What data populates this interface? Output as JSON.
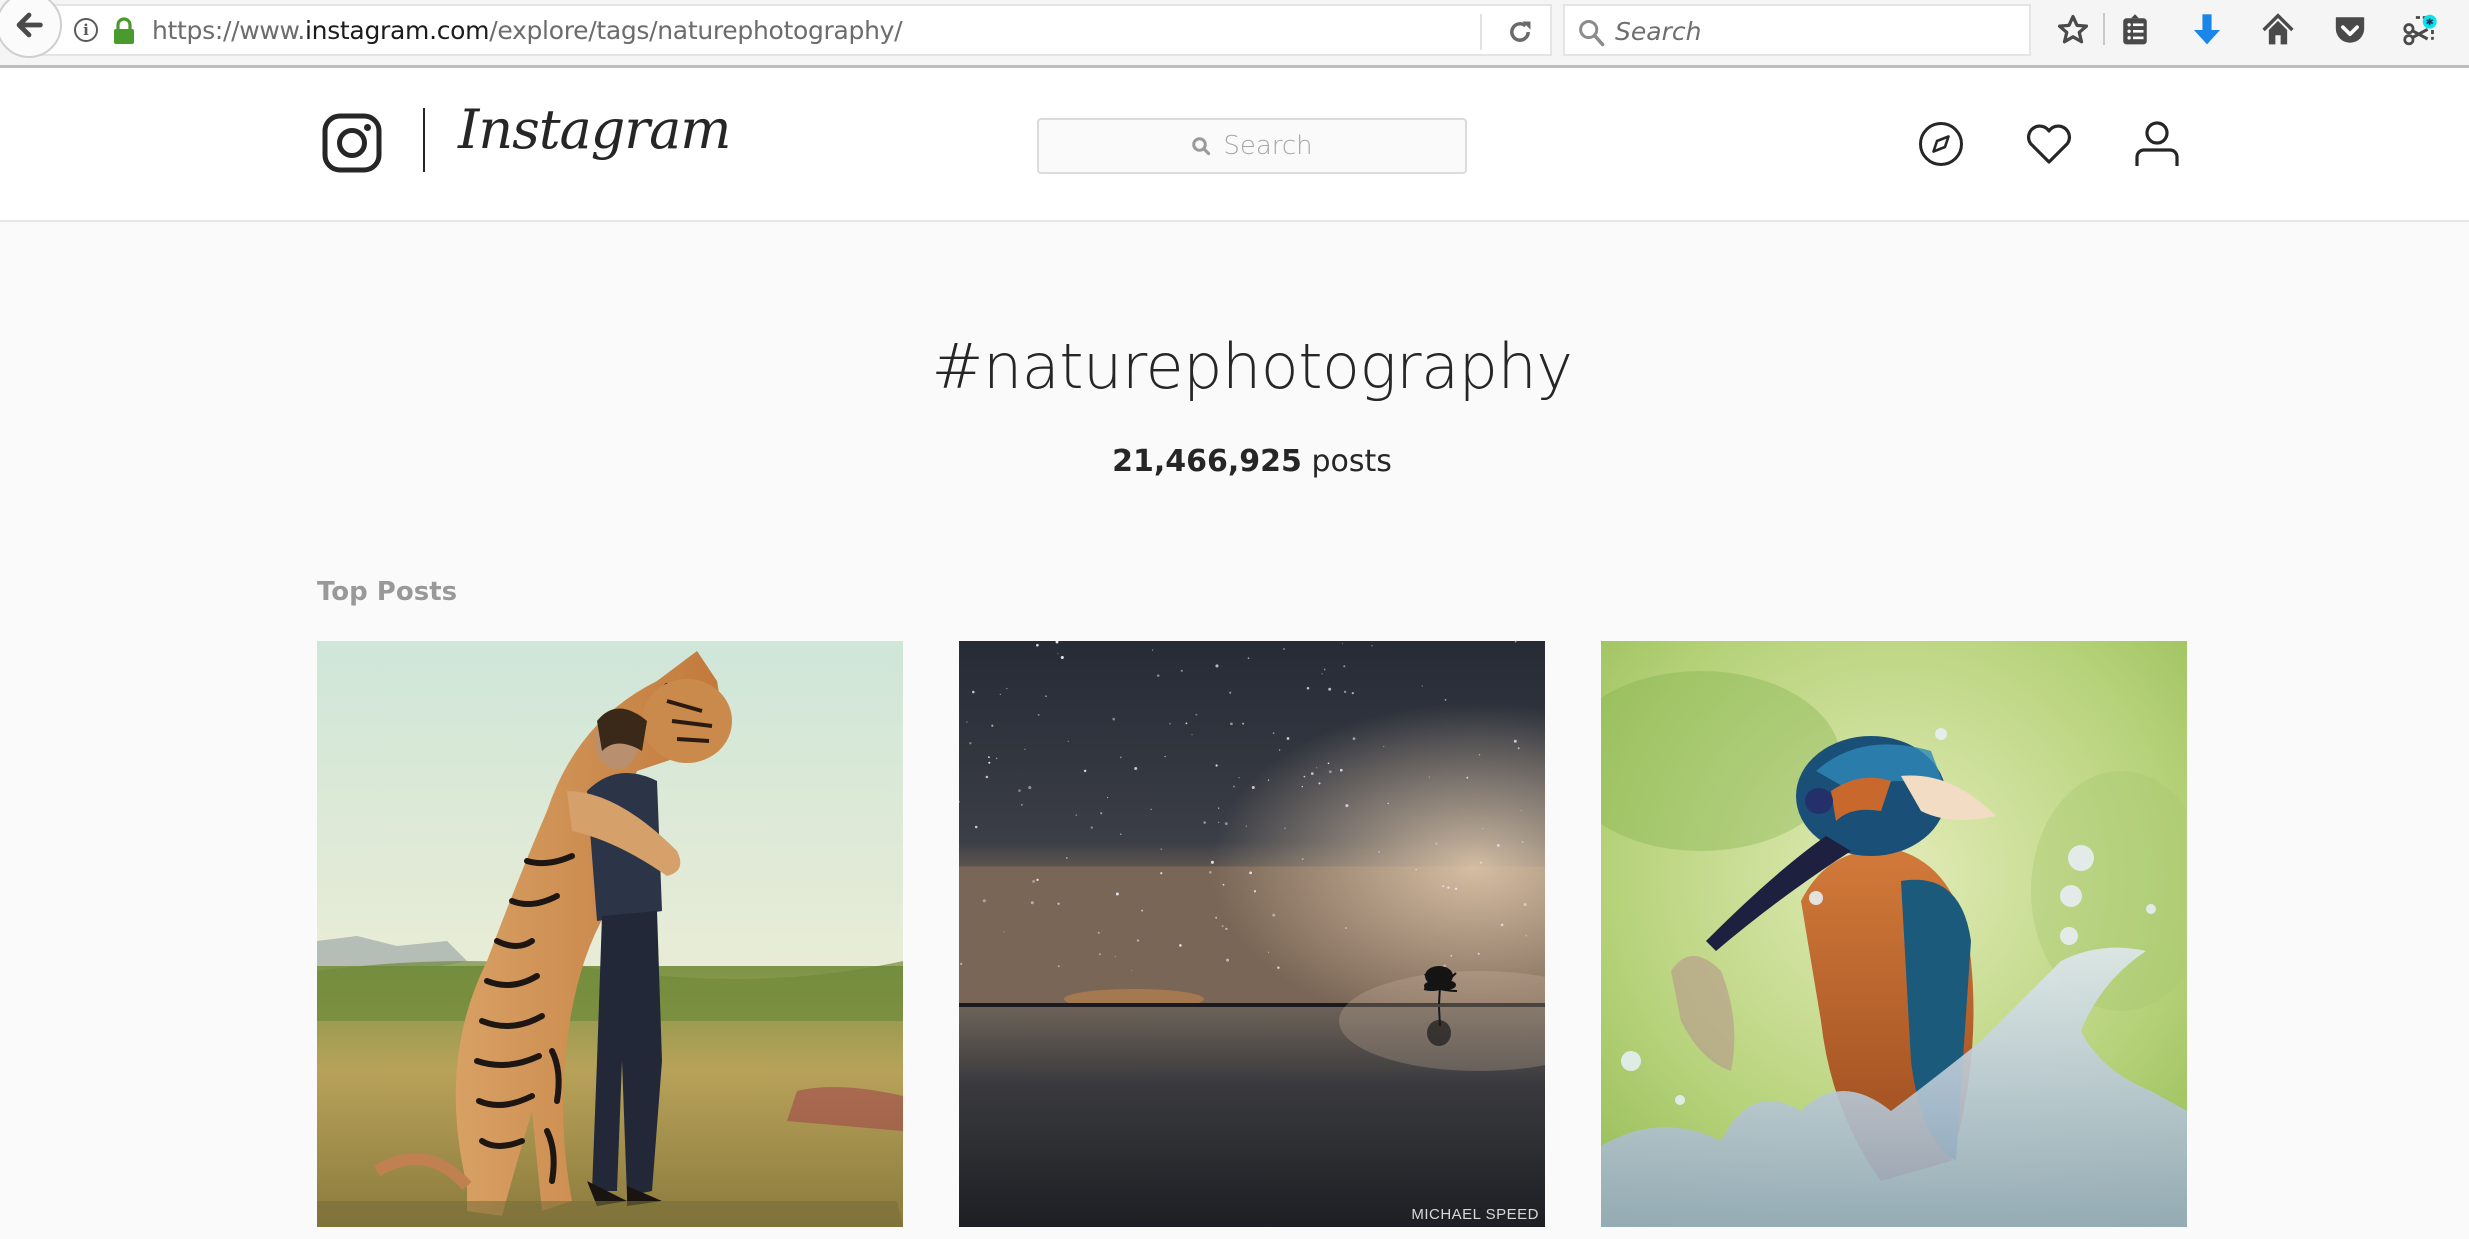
{
  "browser": {
    "url_prefix": "https://www.",
    "url_domain": "instagram.com",
    "url_path": "/explore/tags/naturephotography/",
    "search_placeholder": "Search",
    "icons": [
      "back-icon",
      "info-icon",
      "lock-icon",
      "reload-icon",
      "search-icon",
      "bookmark-star-icon",
      "reading-list-icon",
      "download-icon",
      "home-icon",
      "pocket-icon",
      "screenshot-icon"
    ],
    "download_color": "#1a87e8",
    "lock_color": "#4a9b2d",
    "badge_color": "#00e5f2"
  },
  "header": {
    "wordmark": "Instagram",
    "search_placeholder": "Search",
    "nav_icons": [
      "explore-compass-icon",
      "activity-heart-icon",
      "profile-person-icon"
    ]
  },
  "tag": {
    "title": "#naturephotography",
    "post_count": "21,466,925",
    "post_count_suffix": " posts"
  },
  "top_posts": {
    "label": "Top Posts",
    "posts": [
      {
        "subject": "Man hugging a tiger in a grassy field"
      },
      {
        "subject": "Lone tree reflected in a lake under a starry night sky",
        "watermark": "MICHAEL SPEED"
      },
      {
        "subject": "Kingfisher emerging from a water splash"
      }
    ]
  }
}
